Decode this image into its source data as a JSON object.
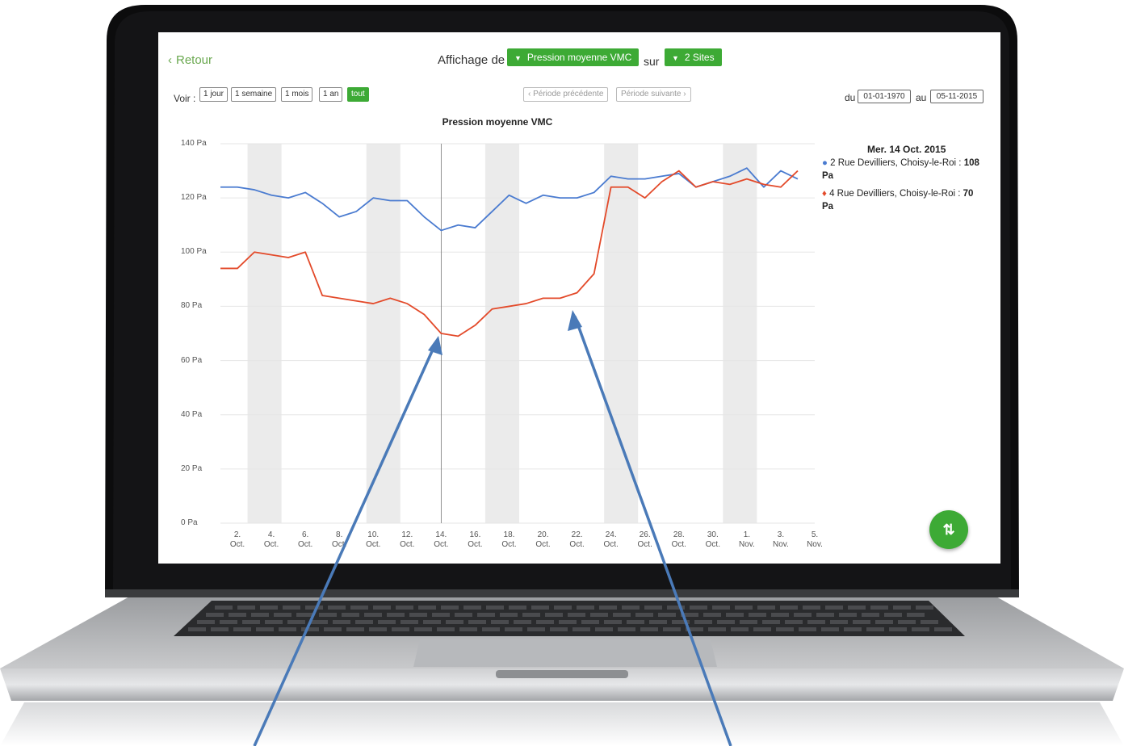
{
  "header": {
    "back_label": "Retour",
    "display_prefix": "Affichage de",
    "metric_dropdown": "Pression moyenne VMC",
    "sites_connector": "sur",
    "sites_dropdown": "2 Sites"
  },
  "range": {
    "voir_label": "Voir :",
    "buttons": [
      "1 jour",
      "1 semaine",
      "1 mois",
      "1 an",
      "tout"
    ],
    "active": "tout"
  },
  "period": {
    "previous": "Période précédente",
    "next": "Période suivante"
  },
  "dates": {
    "from_label": "du",
    "from_value": "01-01-1970",
    "to_label": "au",
    "to_value": "05-11-2015"
  },
  "legend": {
    "date": "Mer. 14 Oct. 2015",
    "items": [
      {
        "name": "2 Rue Devilliers, Choisy-le-Roi",
        "value": "108",
        "unit": "Pa",
        "color": "#4a7bd0"
      },
      {
        "name": "4 Rue Devilliers, Choisy-le-Roi",
        "value": "70",
        "unit": "Pa",
        "color": "#e34a2a"
      }
    ]
  },
  "fab_icon": "sort-arrows-icon",
  "colors": {
    "accent": "#3daa35",
    "series_blue": "#4a7bd0",
    "series_red": "#e34a2a",
    "weekend_band": "#ebebeb",
    "annotation_arrow": "#4a7ab8"
  },
  "chart_data": {
    "type": "line",
    "title": "Pression moyenne VMC",
    "y_tick_labels": [
      "140 Pa",
      "120 Pa",
      "100 Pa",
      "80 Pa",
      "60 Pa",
      "40 Pa",
      "20 Pa",
      "0 Pa"
    ],
    "y_ticks": [
      140,
      120,
      100,
      80,
      60,
      40,
      20,
      0
    ],
    "ylim": [
      0,
      140
    ],
    "x_tick_labels": [
      [
        "2.",
        "Oct."
      ],
      [
        "4.",
        "Oct."
      ],
      [
        "6.",
        "Oct."
      ],
      [
        "8.",
        "Oct."
      ],
      [
        "10.",
        "Oct."
      ],
      [
        "12.",
        "Oct."
      ],
      [
        "14.",
        "Oct."
      ],
      [
        "16.",
        "Oct."
      ],
      [
        "18.",
        "Oct."
      ],
      [
        "20.",
        "Oct."
      ],
      [
        "22.",
        "Oct."
      ],
      [
        "24.",
        "Oct."
      ],
      [
        "26.",
        "Oct."
      ],
      [
        "28.",
        "Oct."
      ],
      [
        "30.",
        "Oct."
      ],
      [
        "1.",
        "Nov."
      ],
      [
        "3.",
        "Nov."
      ],
      [
        "5.",
        "Nov."
      ]
    ],
    "x_dates": [
      "2015-10-01",
      "2015-10-02",
      "2015-10-03",
      "2015-10-04",
      "2015-10-05",
      "2015-10-06",
      "2015-10-07",
      "2015-10-08",
      "2015-10-09",
      "2015-10-10",
      "2015-10-11",
      "2015-10-12",
      "2015-10-13",
      "2015-10-14",
      "2015-10-15",
      "2015-10-16",
      "2015-10-17",
      "2015-10-18",
      "2015-10-19",
      "2015-10-20",
      "2015-10-21",
      "2015-10-22",
      "2015-10-23",
      "2015-10-24",
      "2015-10-25",
      "2015-10-26",
      "2015-10-27",
      "2015-10-28",
      "2015-10-29",
      "2015-10-30",
      "2015-10-31",
      "2015-11-01",
      "2015-11-02",
      "2015-11-03",
      "2015-11-04"
    ],
    "series": [
      {
        "name": "2 Rue Devilliers, Choisy-le-Roi",
        "color": "#4a7bd0",
        "values": [
          124,
          124,
          123,
          121,
          120,
          122,
          118,
          113,
          115,
          120,
          119,
          119,
          113,
          108,
          110,
          109,
          115,
          121,
          118,
          121,
          120,
          120,
          122,
          128,
          127,
          127,
          128,
          129,
          124,
          126,
          128,
          131,
          124,
          130,
          127
        ]
      },
      {
        "name": "4 Rue Devilliers, Choisy-le-Roi",
        "color": "#e34a2a",
        "values": [
          94,
          94,
          100,
          99,
          98,
          100,
          84,
          83,
          82,
          81,
          83,
          81,
          77,
          70,
          69,
          73,
          79,
          80,
          81,
          83,
          83,
          85,
          92,
          124,
          124,
          120,
          126,
          130,
          124,
          126,
          125,
          127,
          125,
          124,
          130
        ]
      }
    ],
    "weekend_bands": [
      [
        "2015-10-03",
        "2015-10-04"
      ],
      [
        "2015-10-10",
        "2015-10-11"
      ],
      [
        "2015-10-17",
        "2015-10-18"
      ],
      [
        "2015-10-24",
        "2015-10-25"
      ],
      [
        "2015-10-31",
        "2015-11-01"
      ]
    ],
    "crosshair_date": "2015-10-14",
    "grid": true,
    "legend_position": "right"
  }
}
